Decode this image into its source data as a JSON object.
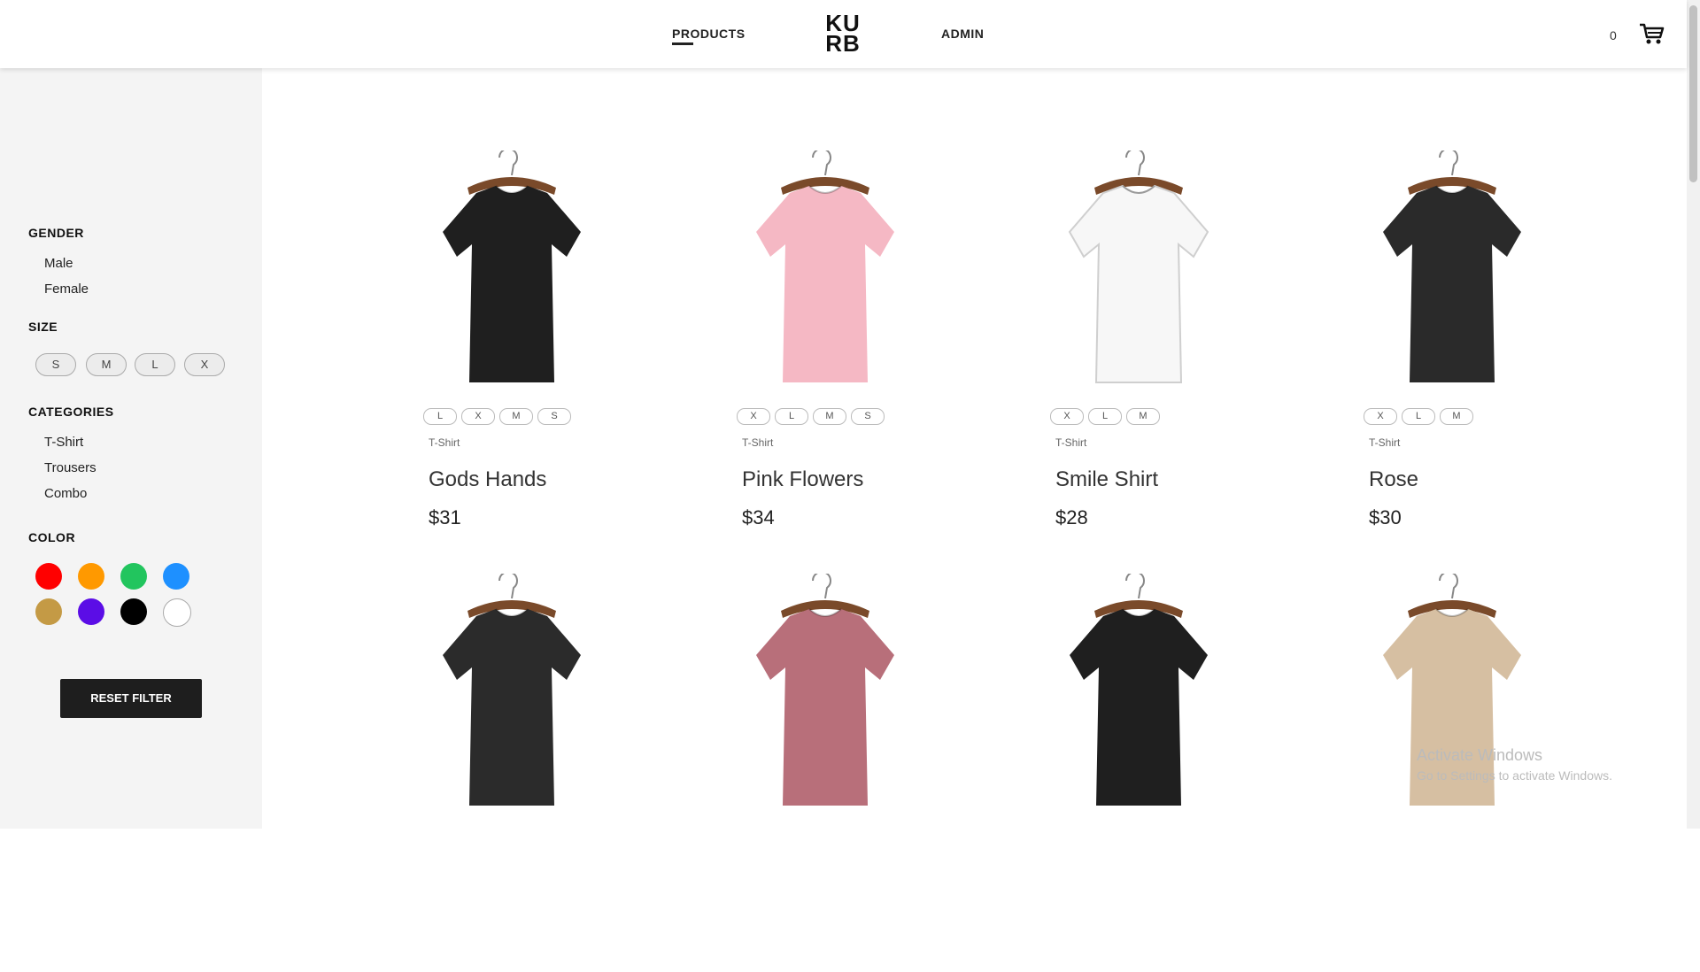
{
  "header": {
    "nav_products": "PRODUCTS",
    "logo_top": "KU",
    "logo_bottom": "RB",
    "nav_admin": "ADMIN",
    "cart_count": "0",
    "cart_icon": "cart-icon"
  },
  "sidebar": {
    "gender_title": "GENDER",
    "genders": [
      "Male",
      "Female"
    ],
    "size_title": "SIZE",
    "sizes": [
      "S",
      "M",
      "L",
      "X"
    ],
    "categories_title": "CATEGORIES",
    "categories": [
      "T-Shirt",
      "Trousers",
      "Combo"
    ],
    "color_title": "COLOR",
    "colors": [
      "#ff0000",
      "#ff9900",
      "#22c55e",
      "#1e90ff",
      "#c49a45",
      "#5b0de6",
      "#000000",
      "#ffffff"
    ],
    "reset_label": "RESET FILTER"
  },
  "products": [
    {
      "sizes": [
        "L",
        "X",
        "M",
        "S"
      ],
      "category": "T-Shirt",
      "name": "Gods Hands",
      "price": "$31",
      "color": "#1f1f1f"
    },
    {
      "sizes": [
        "X",
        "L",
        "M",
        "S"
      ],
      "category": "T-Shirt",
      "name": "Pink Flowers",
      "price": "$34",
      "color": "#f5b8c4"
    },
    {
      "sizes": [
        "X",
        "L",
        "M"
      ],
      "category": "T-Shirt",
      "name": "Smile Shirt",
      "price": "$28",
      "color": "#f7f7f7"
    },
    {
      "sizes": [
        "X",
        "L",
        "M"
      ],
      "category": "T-Shirt",
      "name": "Rose",
      "price": "$30",
      "color": "#2a2a2a"
    },
    {
      "color": "#2b2b2b"
    },
    {
      "color": "#b86f7a"
    },
    {
      "color": "#1f1f1f"
    },
    {
      "color": "#d6bfa2"
    }
  ],
  "watermark": {
    "line1": "Activate Windows",
    "line2": "Go to Settings to activate Windows."
  }
}
